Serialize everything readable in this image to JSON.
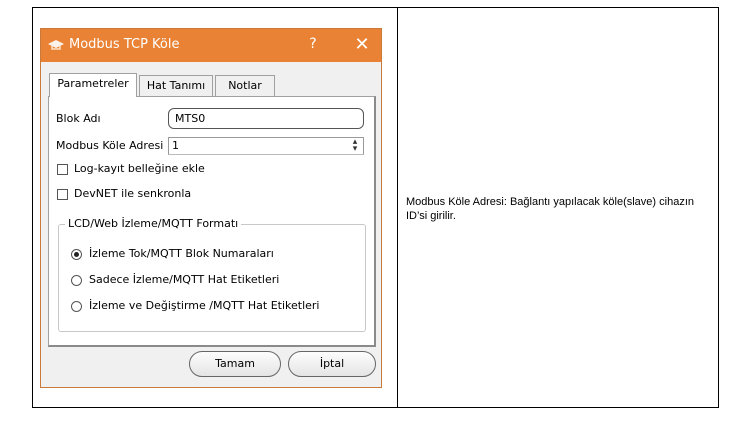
{
  "dialog": {
    "title": "Modbus TCP Köle",
    "help_label": "?",
    "close_label": "✕",
    "tabs": [
      {
        "label": "Parametreler"
      },
      {
        "label": "Hat Tanımı"
      },
      {
        "label": "Notlar"
      }
    ],
    "block_name": {
      "label": "Blok Adı",
      "value": "MTS0"
    },
    "slave_address": {
      "label": "Modbus Köle Adresi",
      "value": "1"
    },
    "log_checkbox": {
      "label": "Log-kayıt belleğine ekle",
      "checked": false
    },
    "devnet_checkbox": {
      "label": "DevNET ile senkronla",
      "checked": false
    },
    "format_group": {
      "title": "LCD/Web İzleme/MQTT Formatı",
      "options": [
        {
          "label": "İzleme Tok/MQTT Blok Numaraları",
          "selected": true
        },
        {
          "label": "Sadece İzleme/MQTT Hat Etiketleri",
          "selected": false
        },
        {
          "label": "İzleme ve Değiştirme /MQTT Hat Etiketleri",
          "selected": false
        }
      ]
    },
    "ok_label": "Tamam",
    "cancel_label": "İptal"
  },
  "description": "Modbus Köle Adresi:  Bağlantı yapılacak köle(slave) cihazın ID’si girilir.",
  "colors": {
    "titlebar": "#e98234",
    "window_bg": "#f0f0f0"
  },
  "icons": {
    "title_icon": "app-logo-icon",
    "spin": "spin-arrows-icon"
  }
}
